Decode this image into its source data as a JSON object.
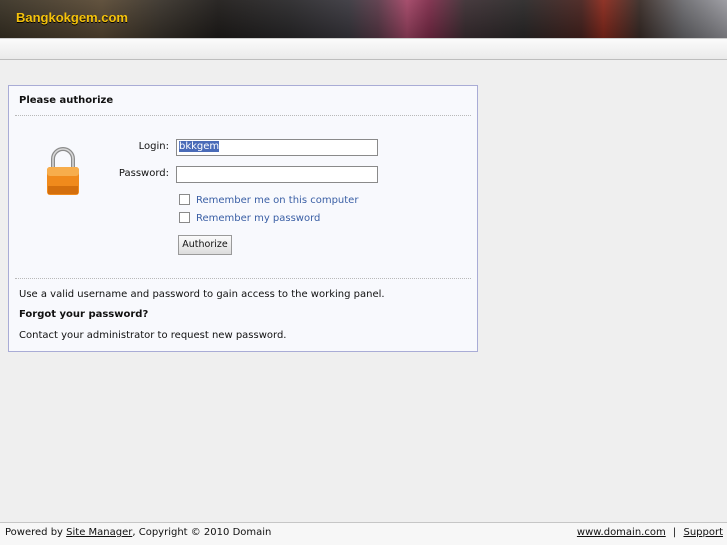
{
  "header": {
    "site_name": "Bangkokgem.com"
  },
  "panel": {
    "title": "Please authorize",
    "login_label": "Login:",
    "login_value": "bkkgem",
    "password_label": "Password:",
    "password_value": "",
    "remember_computer_label": "Remember me on this computer",
    "remember_computer_checked": false,
    "remember_password_label": "Remember my password",
    "remember_password_checked": false,
    "authorize_label": "Authorize",
    "info_text": "Use a valid username and password to gain access to the working panel.",
    "forgot_heading": "Forgot your password?",
    "forgot_text": "Contact your administrator to request new password."
  },
  "footer": {
    "powered_prefix": "Powered by ",
    "site_manager_link": "Site Manager",
    "copyright": ", Copyright © 2010 Domain",
    "domain_link": "www.domain.com",
    "separator": "|",
    "support_link": "Support"
  },
  "icons": {
    "lock": "lock-icon"
  },
  "colors": {
    "accent_logo": "#f5c20b",
    "panel_border": "#a9acd6",
    "link_blue": "#3a5fa5",
    "lock_orange": "#f08a1c"
  }
}
